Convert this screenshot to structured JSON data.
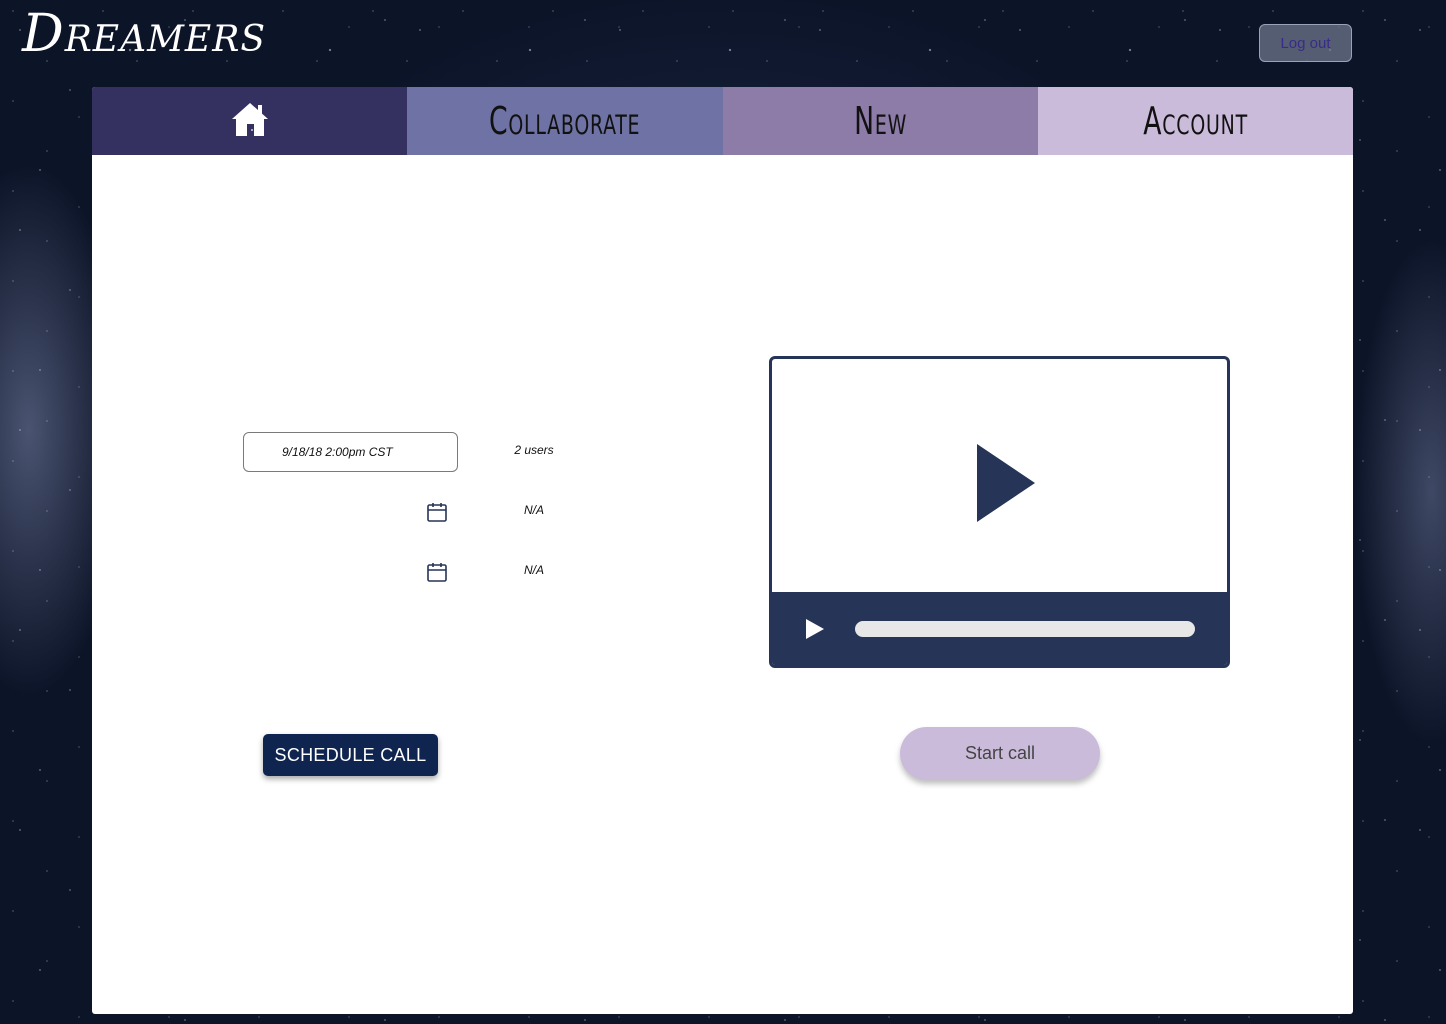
{
  "app": {
    "logo": "Dreamers"
  },
  "header": {
    "logout_label": "Log out"
  },
  "nav": {
    "home_icon": "home-icon",
    "collaborate_label": "Collaborate",
    "new_label": "New",
    "account_label": "Account"
  },
  "schedule": {
    "date_value": "9/18/18   2:00pm CST",
    "rows": [
      {
        "users": "2 users"
      },
      {
        "users": "N/A",
        "icon": "calendar-icon"
      },
      {
        "users": "N/A",
        "icon": "calendar-icon"
      }
    ],
    "button_label": "SCHEDULE CALL"
  },
  "video": {
    "play_icon": "play-icon",
    "progress_value": 0
  },
  "call": {
    "start_label": "Start call"
  },
  "colors": {
    "nav_home": "#34305f",
    "nav_collaborate": "#6f72a4",
    "nav_new": "#8d7ba8",
    "nav_account": "#cbbbdb",
    "primary_button": "#0f2550",
    "video_dark": "#263457",
    "start_button": "#cbbbdb"
  }
}
